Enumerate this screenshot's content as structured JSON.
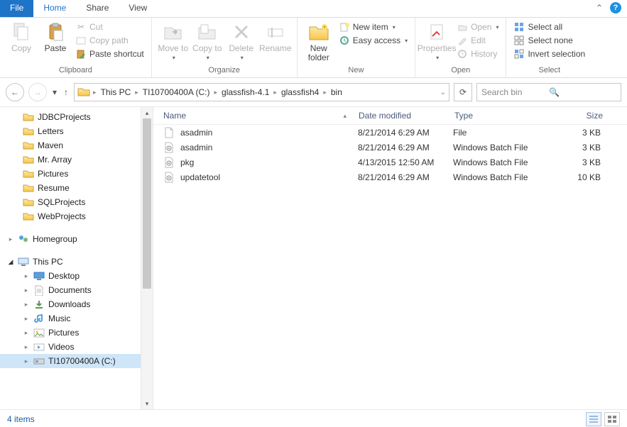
{
  "tabs": {
    "file": "File",
    "home": "Home",
    "share": "Share",
    "view": "View"
  },
  "ribbon": {
    "clipboard": {
      "label": "Clipboard",
      "copy": "Copy",
      "paste": "Paste",
      "cut": "Cut",
      "copy_path": "Copy path",
      "paste_shortcut": "Paste shortcut"
    },
    "organize": {
      "label": "Organize",
      "move_to": "Move to",
      "copy_to": "Copy to",
      "delete": "Delete",
      "rename": "Rename"
    },
    "new": {
      "label": "New",
      "new_folder": "New folder",
      "new_item": "New item",
      "easy_access": "Easy access"
    },
    "open": {
      "label": "Open",
      "properties": "Properties",
      "open": "Open",
      "edit": "Edit",
      "history": "History"
    },
    "select": {
      "label": "Select",
      "select_all": "Select all",
      "select_none": "Select none",
      "invert": "Invert selection"
    }
  },
  "breadcrumb": [
    "This PC",
    "TI10700400A (C:)",
    "glassfish-4.1",
    "glassfish4",
    "bin"
  ],
  "search_placeholder": "Search bin",
  "nav": {
    "folders": [
      "JDBCProjects",
      "Letters",
      "Maven",
      "Mr. Array",
      "Pictures",
      "Resume",
      "SQLProjects",
      "WebProjects"
    ],
    "homegroup": "Homegroup",
    "thispc": "This PC",
    "pc_items": [
      "Desktop",
      "Documents",
      "Downloads",
      "Music",
      "Pictures",
      "Videos"
    ],
    "drive": "TI10700400A (C:)"
  },
  "columns": {
    "name": "Name",
    "date": "Date modified",
    "type": "Type",
    "size": "Size"
  },
  "files": [
    {
      "name": "asadmin",
      "date": "8/21/2014 6:29 AM",
      "type": "File",
      "size": "3 KB",
      "icon": "file"
    },
    {
      "name": "asadmin",
      "date": "8/21/2014 6:29 AM",
      "type": "Windows Batch File",
      "size": "3 KB",
      "icon": "batch"
    },
    {
      "name": "pkg",
      "date": "4/13/2015 12:50 AM",
      "type": "Windows Batch File",
      "size": "3 KB",
      "icon": "batch"
    },
    {
      "name": "updatetool",
      "date": "8/21/2014 6:29 AM",
      "type": "Windows Batch File",
      "size": "10 KB",
      "icon": "batch"
    }
  ],
  "status": "4 items"
}
